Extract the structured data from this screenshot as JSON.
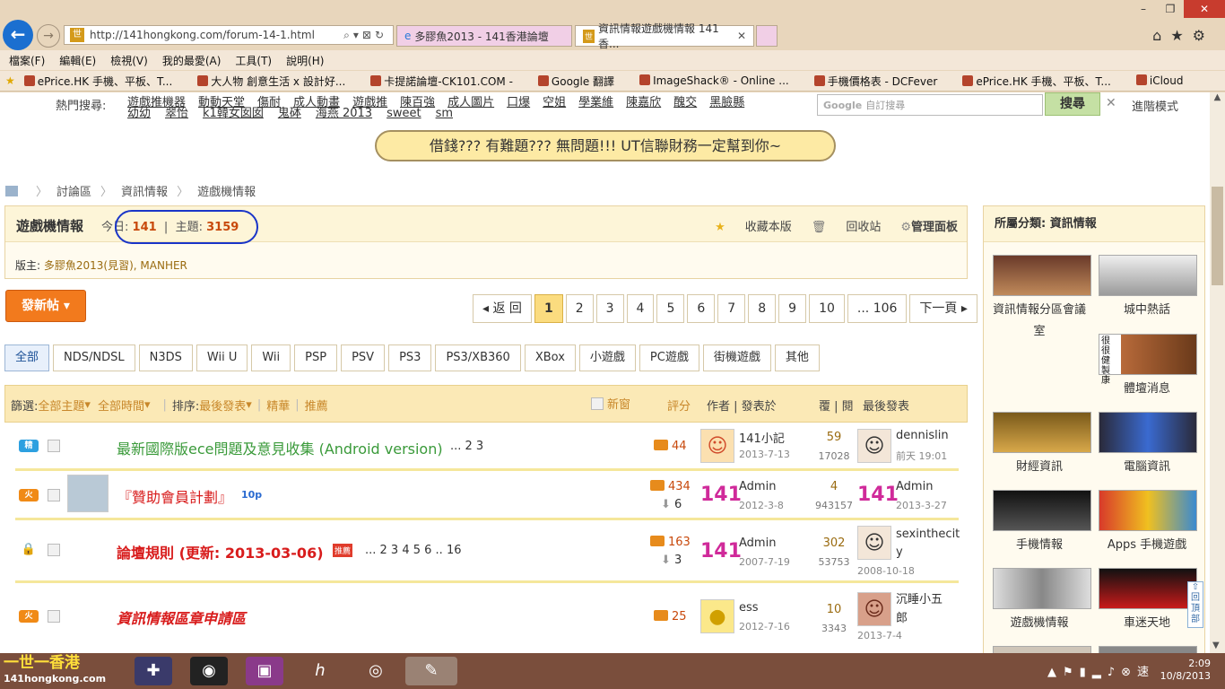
{
  "browser": {
    "url": "http://141hongkong.com/forum-14-1.html",
    "tabs": [
      "多膠魚2013 - 141香港論壇",
      "資訊情報遊戲機情報 141香...",
      ""
    ],
    "menu": [
      "檔案(F)",
      "編輯(E)",
      "檢視(V)",
      "我的最愛(A)",
      "工具(T)",
      "說明(H)"
    ],
    "favorites": [
      "ePrice.HK 手機、平板、T...",
      "大人物 創意生活 x 設計好...",
      "卡提諾論壇-CK101.COM -",
      "Google 翻譯",
      "ImageShack® - Online ...",
      "手機價格表 - DCFever",
      "ePrice.HK 手機、平板、T...",
      "iCloud"
    ],
    "window_controls": [
      "–",
      "❐",
      "✕"
    ]
  },
  "hot": {
    "label": "熱門搜尋:",
    "row1": [
      "遊戲推機器",
      "動動天堂",
      "傷耐",
      "成人動畫",
      "遊戲推",
      "陳百強",
      "成人圖片",
      "口爆",
      "空姐",
      "學業維",
      "陳嘉欣",
      "醜交",
      "黑臉縣"
    ],
    "row2": [
      "幼幼",
      "翠怡",
      "k1韓女囡囡",
      "鬼砵",
      "海燕 2013",
      "sweet",
      "sm"
    ]
  },
  "search": {
    "placeholder": "自訂搜尋",
    "button": "搜尋",
    "close": "✕",
    "advanced": "進階模式"
  },
  "ad": "借錢??? 有難題??? 無問題!!! UT信聯財務一定幫到你~",
  "breadcrumb": [
    "討論區",
    "資訊情報",
    "遊戲機情報"
  ],
  "forum": {
    "title": "遊戲機情報",
    "today_label": "今日:",
    "today": "141",
    "topics_label": "主題:",
    "topics": "3159",
    "actions": [
      "收藏本版",
      "回收站",
      "管理面板"
    ],
    "mods_label": "版主:",
    "mods": "多膠魚2013(見習), MANHER"
  },
  "new_post": "發新帖 ▾",
  "pager": [
    "◂ 返 回",
    "1",
    "2",
    "3",
    "4",
    "5",
    "6",
    "7",
    "8",
    "9",
    "10",
    "... 106",
    "下一頁 ▸"
  ],
  "type_tabs": [
    "全部",
    "NDS/NDSL",
    "N3DS",
    "Wii U",
    "Wii",
    "PSP",
    "PSV",
    "PS3",
    "PS3/XB360",
    "XBox",
    "小遊戲",
    "PC遊戲",
    "街機遊戲",
    "其他"
  ],
  "filter": {
    "label": "篩選:",
    "all_topics": "全部主題",
    "all_time": "全部時間",
    "sort_label": "排序:",
    "sort": "最後發表",
    "digest": "精華",
    "recommend": "推薦",
    "newwin": "新窗",
    "rate": "評分",
    "author": "作者",
    "posted": "發表於",
    "reply": "覆",
    "view": "閱",
    "last": "最後發表"
  },
  "threads": [
    {
      "badge": "精",
      "badge_color": "#2da0e0",
      "title": "最新國際版ece問題及意見收集 (Android version)",
      "title_color": "#3a9a3a",
      "pages": "... 2  3",
      "rate": "44",
      "down": "",
      "author": "141小記",
      "date": "2013-7-13",
      "replies": "59",
      "views": "17028",
      "last_user": "dennislin",
      "last_date": "前天 19:01"
    },
    {
      "badge": "火",
      "badge_color": "#f08a16",
      "title": "『贊助會員計劃』",
      "title_color": "#d81c1c",
      "pages": "10p",
      "rate": "434",
      "down": "6",
      "author": "Admin",
      "date": "2012-3-8",
      "replies": "4",
      "views": "943157",
      "last_user": "Admin",
      "last_date": "2013-3-27"
    },
    {
      "badge": "🔒",
      "badge_color": "#f0c020",
      "title": "論壇規則 (更新: 2013-03-06)",
      "title_color": "#d81c1c",
      "tag": "推薦",
      "pages": "... 2  3  4  5  6 .. 16",
      "rate": "163",
      "down": "3",
      "author": "Admin",
      "date": "2007-7-19",
      "replies": "302",
      "views": "53753",
      "last_user": "sexinthecity",
      "last_date": "2008-10-18"
    },
    {
      "badge": "火",
      "badge_color": "#f08a16",
      "title": "資訊情報區章申請區",
      "title_color": "#d81c1c",
      "pages": "",
      "rate": "25",
      "down": "",
      "author": "ess",
      "date": "2012-7-16",
      "replies": "10",
      "views": "3343",
      "last_user": "沉睡小五郎",
      "last_date": "2013-7-4"
    }
  ],
  "sidebar": {
    "title": "所屬分類: 資訊情報",
    "items": [
      "資訊情報分區會議室",
      "城中熱話",
      "體壇消息",
      "財經資訊",
      "電腦資訊",
      "手機情報",
      "Apps 手機遊戲",
      "遊戲機情報",
      "車迷天地"
    ],
    "health_text": "很很健製康",
    "back_top": "回頂部"
  },
  "taskbar": {
    "logo": "一世一香港",
    "logo_sub": "141hongkong.com",
    "time": "2:09",
    "date": "10/8/2013",
    "ime": "速"
  }
}
